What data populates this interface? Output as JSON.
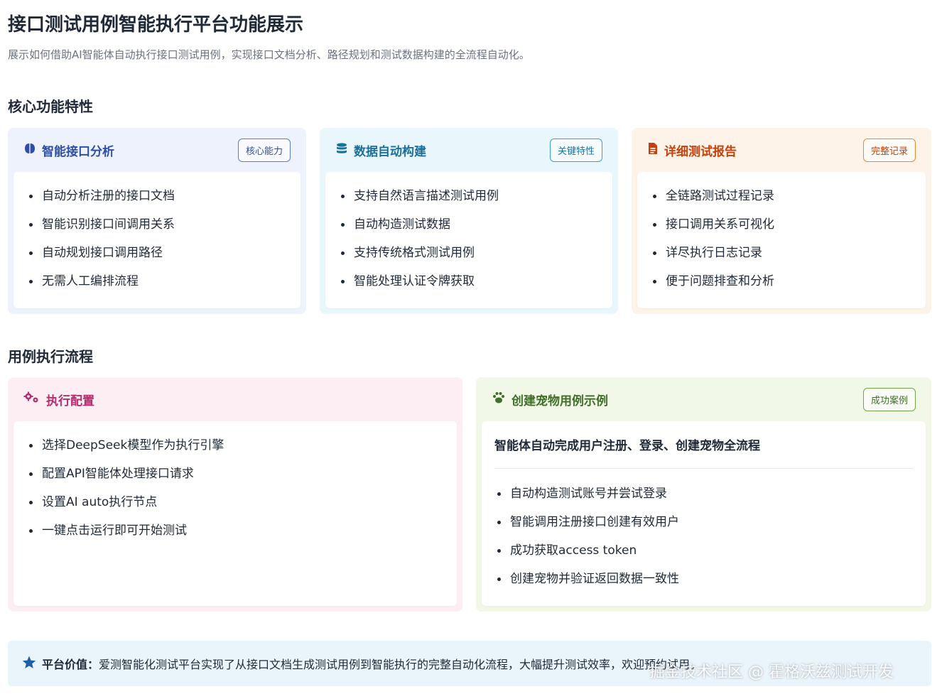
{
  "page": {
    "title": "接口测试用例智能执行平台功能展示",
    "subtitle": "展示如何借助AI智能体自动执行接口测试用例，实现接口文档分析、路径规划和测试数据构建的全流程自动化。"
  },
  "sections": {
    "features_title": "核心功能特性",
    "flow_title": "用例执行流程"
  },
  "features": [
    {
      "icon": "brain-icon",
      "title": "智能接口分析",
      "badge": "核心能力",
      "items": [
        "自动分析注册的接口文档",
        "智能识别接口间调用关系",
        "自动规划接口调用路径",
        "无需人工编排流程"
      ]
    },
    {
      "icon": "database-icon",
      "title": "数据自动构建",
      "badge": "关键特性",
      "items": [
        "支持自然语言描述测试用例",
        "自动构造测试数据",
        "支持传统格式测试用例",
        "智能处理认证令牌获取"
      ]
    },
    {
      "icon": "file-icon",
      "title": "详细测试报告",
      "badge": "完整记录",
      "items": [
        "全链路测试过程记录",
        "接口调用关系可视化",
        "详尽执行日志记录",
        "便于问题排查和分析"
      ]
    }
  ],
  "flow": {
    "config": {
      "icon": "gears-icon",
      "title": "执行配置",
      "items": [
        "选择DeepSeek模型作为执行引擎",
        "配置API智能体处理接口请求",
        "设置AI auto执行节点",
        "一键点击运行即可开始测试"
      ]
    },
    "example": {
      "icon": "paw-icon",
      "title": "创建宠物用例示例",
      "badge": "成功案例",
      "heading": "智能体自动完成用户注册、登录、创建宠物全流程",
      "items": [
        "自动构造测试账号并尝试登录",
        "智能调用注册接口创建有效用户",
        "成功获取access token",
        "创建宠物并验证返回数据一致性"
      ]
    }
  },
  "footer": {
    "icon": "star-icon",
    "label": "平台价值：",
    "text": "爱测智能化测试平台实现了从接口文档生成测试用例到智能执行的完整自动化流程，大幅提升测试效率，欢迎预约试用。"
  },
  "watermark": "掘金技术社区 @ 霍格沃兹测试开发",
  "colors": {
    "blue": "#2f4ea8",
    "cyan": "#1b6f9c",
    "orange": "#c2410c",
    "pink": "#b0306e",
    "green": "#3f6f2a",
    "footer_star": "#1e5fa8"
  }
}
